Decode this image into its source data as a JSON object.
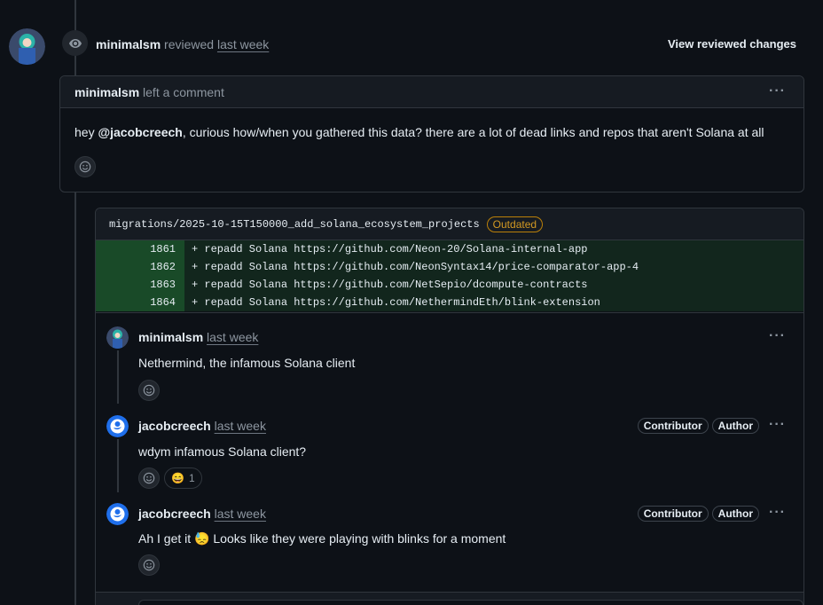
{
  "review": {
    "user": "minimalsm",
    "action": "reviewed",
    "time": "last week",
    "view_changes_label": "View reviewed changes"
  },
  "comment": {
    "user": "minimalsm",
    "action": "left a comment",
    "body_prefix": "hey ",
    "mention": "@jacobcreech",
    "body_suffix": ", curious how/when you gathered this data? there are a lot of dead links and repos that aren't Solana at all"
  },
  "file": {
    "path": "migrations/2025-10-15T150000_add_solana_ecosystem_projects",
    "badge": "Outdated",
    "lines": [
      {
        "num": "1861",
        "code": "+ repadd Solana https://github.com/Neon-20/Solana-internal-app"
      },
      {
        "num": "1862",
        "code": "+ repadd Solana https://github.com/NeonSyntax14/price-comparator-app-4"
      },
      {
        "num": "1863",
        "code": "+ repadd Solana https://github.com/NetSepio/dcompute-contracts"
      },
      {
        "num": "1864",
        "code": "+ repadd Solana https://github.com/NethermindEth/blink-extension"
      }
    ]
  },
  "replies": [
    {
      "user": "minimalsm",
      "time": "last week",
      "body": "Nethermind, the infamous Solana client"
    },
    {
      "user": "jacobcreech",
      "time": "last week",
      "body": "wdym infamous Solana client?",
      "tags": [
        "Contributor",
        "Author"
      ],
      "reaction_emoji": "😄",
      "reaction_count": "1"
    },
    {
      "user": "jacobcreech",
      "time": "last week",
      "body_prefix": "Ah I get it ",
      "body_emoji": "😓",
      "body_suffix": " Looks like they were playing with blinks for a moment",
      "tags": [
        "Contributor",
        "Author"
      ]
    }
  ],
  "icons": {
    "eye": "eye-icon",
    "smiley": "smiley-icon",
    "kebab": "kebab-horizontal-icon"
  },
  "colors": {
    "background": "#0d1117",
    "border": "#30363d",
    "outdated": "#d29922",
    "diff_add": "#2ea043"
  }
}
